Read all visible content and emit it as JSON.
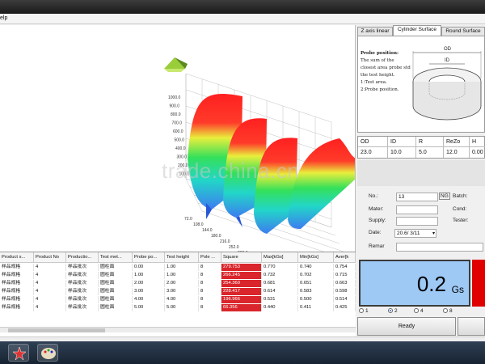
{
  "menu": {
    "partial_label": "elp"
  },
  "tabs": [
    "Z axis linear",
    "Cylinder Surface",
    "Round Surface"
  ],
  "diagram": {
    "note_lines": [
      "Probe position:",
      "The sum of the",
      "closest area probe std",
      "the test height.",
      "1:Test area.",
      "2:Probe position."
    ],
    "od_label": "OD",
    "id_label": "ID"
  },
  "dims": {
    "headers": [
      "OD",
      "ID",
      "R",
      "ReZo",
      "H"
    ],
    "values": [
      "23.0",
      "10.0",
      "5.0",
      "12.0",
      "0.00"
    ]
  },
  "form": {
    "no_label": "No.:",
    "no_value": "13",
    "ng_label": "NG",
    "batch_label": "Batch:",
    "mater_label": "Mater:",
    "cond_label": "Cond:",
    "supply_label": "Supply:",
    "tester_label": "Tester:",
    "date_label": "Date:",
    "date_value": "20.6/ 3/11",
    "remark_label": "Remar"
  },
  "readout": {
    "value": "0.2",
    "unit": "Gs"
  },
  "radios": [
    "1",
    "2",
    "4",
    "8"
  ],
  "selected_radio": "2",
  "buttons": {
    "ready": "Ready"
  },
  "grid": {
    "headers": [
      "Product s...",
      "Product No",
      "Productio...",
      "Test met...",
      "Probe po...",
      "Test height",
      "Pole ...",
      "Square",
      "Max[kGs]",
      "Min[kGs]",
      "Aver[k"
    ],
    "rows": [
      [
        "样品规格",
        "4",
        "样品批次",
        "圆柱面",
        "0.00",
        "1.00",
        "8",
        "279.753",
        "0.770",
        "0.740",
        "0.754"
      ],
      [
        "样品规格",
        "4",
        "样品批次",
        "圆柱面",
        "1.00",
        "1.00",
        "8",
        "266.245",
        "0.732",
        "0.702",
        "0.715"
      ],
      [
        "样品规格",
        "4",
        "样品批次",
        "圆柱面",
        "2.00",
        "2.00",
        "8",
        "254.360",
        "0.681",
        "0.651",
        "0.663"
      ],
      [
        "样品规格",
        "4",
        "样品批次",
        "圆柱面",
        "3.00",
        "3.00",
        "8",
        "228.417",
        "0.614",
        "0.583",
        "0.598"
      ],
      [
        "样品规格",
        "4",
        "样品批次",
        "圆柱面",
        "4.00",
        "4.00",
        "8",
        "196.966",
        "0.531",
        "0.500",
        "0.514"
      ],
      [
        "样品规格",
        "4",
        "样品批次",
        "圆柱面",
        "5.00",
        "5.00",
        "8",
        "66.356",
        "0.440",
        "0.411",
        "0.425"
      ]
    ]
  },
  "plot_axis": {
    "z_ticks": [
      "1000.0",
      "900.0",
      "800.0",
      "700.0",
      "600.0",
      "500.0",
      "400.0",
      "300.0",
      "200.0",
      "100.0"
    ],
    "x_ticks": [
      "72.0",
      "108.0",
      "144.0",
      "180.0",
      "216.0",
      "252.0",
      "288.0",
      "324.0"
    ]
  },
  "watermark": "trade.china.cn"
}
